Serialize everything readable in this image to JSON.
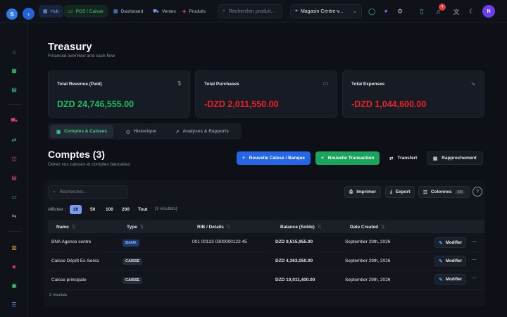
{
  "topbar": {
    "logo_letter": "S",
    "expand_icon": "›",
    "nav": [
      {
        "label": "Hub",
        "icon": "grid-icon"
      },
      {
        "label": "POS / Caisse",
        "icon": "monitor-icon"
      },
      {
        "label": "Dashboard",
        "icon": "dashboard-icon"
      },
      {
        "label": "Ventes",
        "icon": "cart-icon"
      },
      {
        "label": "Produits",
        "icon": "box-icon"
      }
    ],
    "search_placeholder": "Rechercher produit...",
    "store": "Magasin Centre-v...",
    "notifications_count": "4",
    "avatar_letter": "N"
  },
  "header": {
    "title": "Treasury",
    "subtitle": "Financial overview and cash flow"
  },
  "cards": [
    {
      "label": "Total Revenue (Paid)",
      "icon": "$",
      "value": "DZD 24,746,555.00",
      "color": "#1fbe6b"
    },
    {
      "label": "Total Purchases",
      "icon": "card-icon",
      "value": "-DZD 2,011,550.00",
      "color": "#e6262a"
    },
    {
      "label": "Total Expenses",
      "icon": "trend-down-icon",
      "value": "-DZD 1,044,600.00",
      "color": "#e6262a"
    }
  ],
  "tabs": [
    {
      "label": "Comptes & Caisses"
    },
    {
      "label": "Historique"
    },
    {
      "label": "Analyses & Rapports"
    }
  ],
  "comptes": {
    "title": "Comptes (3)",
    "subtitle": "Gérez vos caisses et comptes bancaires",
    "btn_new_caisse": "Nouvelle Caisse / Banque",
    "btn_new_transaction": "Nouvelle Transaction",
    "btn_transfert": "Transfert",
    "btn_rapprochement": "Rapprochement"
  },
  "table_tools": {
    "search_placeholder": "Rechercher...",
    "print": "Imprimer",
    "export": "Export",
    "columns": "Colonnes",
    "columns_count": "5/5",
    "show_label": "Afficher :",
    "page_sizes": [
      "20",
      "50",
      "100",
      "200",
      "Tout"
    ],
    "result_count": "(3 résultats)"
  },
  "table": {
    "headers": [
      "Name",
      "Type",
      "RIB / Details",
      "Balance (Solde)",
      "Date Created"
    ],
    "rows": [
      {
        "name": "BNA Agence centre",
        "type": "BANK",
        "rib": "001 00123 0300000123 45",
        "balance": "DZD 9,515,955.00",
        "date": "September 29th, 2026"
      },
      {
        "name": "Caisse Dépôt Es-Senia",
        "type": "CAISSE",
        "rib": "",
        "balance": "DZD 4,363,050.00",
        "date": "September 29th, 2026"
      },
      {
        "name": "Caisse principale",
        "type": "CAISSE",
        "rib": "",
        "balance": "DZD 10,011,400.00",
        "date": "September 29th, 2026"
      }
    ],
    "edit_label": "Modifier",
    "footer": "3 résultats"
  }
}
